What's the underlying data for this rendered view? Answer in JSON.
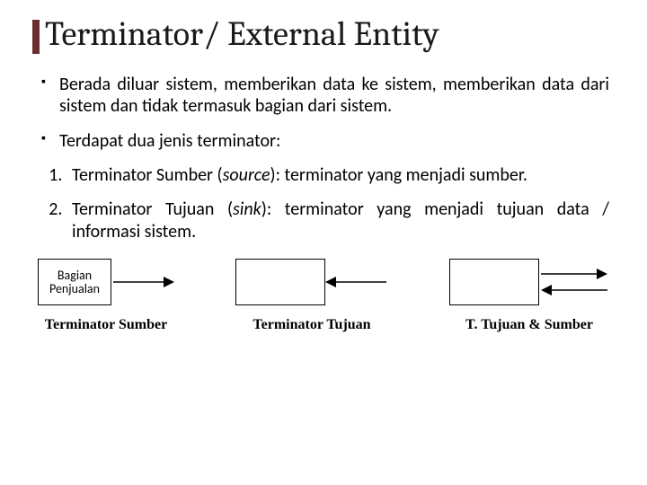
{
  "title": "Terminator/ External Entity",
  "bullets": [
    "Berada diluar sistem, memberikan data ke sistem, memberikan data dari sistem dan tidak termasuk bagian dari sistem.",
    "Terdapat dua jenis terminator:"
  ],
  "numbered": [
    {
      "prefix": "Terminator Sumber (",
      "italic": "source",
      "suffix": "): terminator yang menjadi sumber."
    },
    {
      "prefix": "Terminator Tujuan (",
      "italic": "sink",
      "suffix": "): terminator yang menjadi tujuan data / informasi sistem."
    }
  ],
  "diagram": {
    "box_label_line1": "Bagian",
    "box_label_line2": "Penjualan",
    "captions": [
      "Terminator Sumber",
      "Terminator Tujuan",
      "T. Tujuan & Sumber"
    ]
  }
}
